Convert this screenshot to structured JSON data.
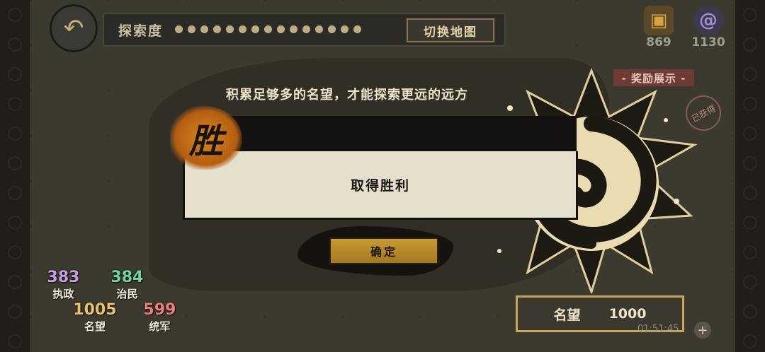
{
  "top_bar": {
    "explore_label": "探索度",
    "switch_map_label": "切换地图",
    "progress_dots": 15
  },
  "resources": [
    {
      "value": "869",
      "icon": "totem-icon",
      "color": "#c8953a"
    },
    {
      "value": "1130",
      "icon": "spiral-icon",
      "color": "#8f7fb0"
    }
  ],
  "reward_panel": {
    "tag_label": "- 奖励展示 -",
    "claimed_label": "已获得"
  },
  "dialog": {
    "notice": "积累足够多的名望，才能探索更远的远方",
    "badge": "胜",
    "message": "取得胜利",
    "confirm_label": "确定"
  },
  "fame": {
    "label": "名望",
    "value": "1000"
  },
  "timer": "01:51:45",
  "stats": [
    {
      "value": "383",
      "label": "执政",
      "color": "#c79de0"
    },
    {
      "value": "384",
      "label": "治民",
      "color": "#6fd6a0"
    },
    {
      "value": "1005",
      "label": "名望",
      "color": "#e8c36a"
    },
    {
      "value": "599",
      "label": "统军",
      "color": "#ef7d7d"
    }
  ]
}
